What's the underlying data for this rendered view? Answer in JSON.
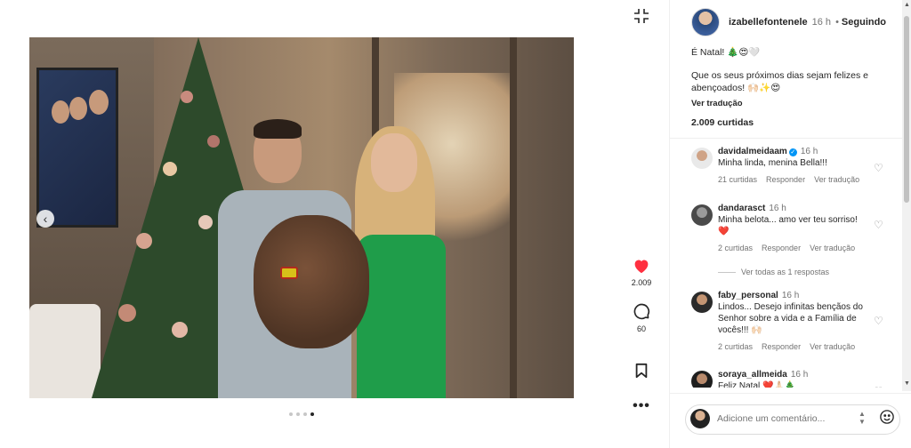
{
  "post": {
    "author": "izabellefontenele",
    "time": "16 h",
    "separator": "•",
    "follow_state": "Seguindo",
    "caption_line1": "É Natal! 🎄😍🤍",
    "caption_line2": "Que os seus próximos dias sejam felizes e abençoados! 🙌🏻✨😍",
    "translate": "Ver tradução",
    "likes": "2.009 curtidas"
  },
  "actions": {
    "like_count": "2.009",
    "comment_count": "60"
  },
  "comments": [
    {
      "user": "davidalmeidaam",
      "verified": true,
      "time": "16 h",
      "text": "Minha linda, menina Bella!!!",
      "likes": "21 curtidas",
      "reply": "Responder",
      "translate": "Ver tradução"
    },
    {
      "user": "dandarasct",
      "time": "16 h",
      "text": "Minha belota... amo ver teu sorriso! ❤️",
      "likes": "2 curtidas",
      "reply": "Responder",
      "translate": "Ver tradução",
      "replies": "Ver todas as 1 respostas"
    },
    {
      "user": "faby_personal",
      "time": "16 h",
      "text": "Lindos... Desejo infinitas bençãos do Senhor sobre a vida e a Família de vocês!!! 🙌🏻",
      "likes": "2 curtidas",
      "reply": "Responder",
      "translate": "Ver tradução"
    },
    {
      "user": "soraya_allmeida",
      "time": "16 h",
      "text": "Feliz Natal ❤️🙏🏻🎄"
    }
  ],
  "composer": {
    "placeholder": "Adicione um comentário..."
  },
  "carousel": {
    "total": 4,
    "active_index": 3
  },
  "colors": {
    "like_red": "#ff3040",
    "verified_blue": "#0095f6",
    "dress_green": "#1f9d4a"
  }
}
